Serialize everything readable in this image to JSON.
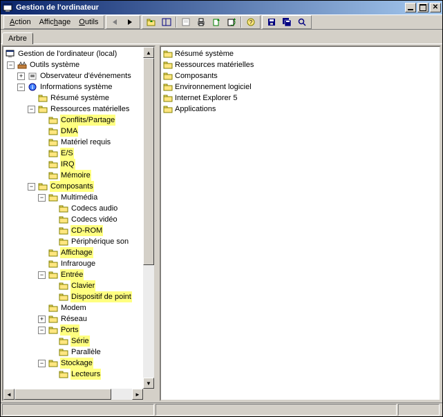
{
  "title": "Gestion de l'ordinateur",
  "menu": {
    "action": "Action",
    "affichage": "Affichage",
    "outils": "Outils"
  },
  "tab": "Arbre",
  "tree": {
    "root": "Gestion de l'ordinateur (local)",
    "outils_systeme": "Outils système",
    "observateur": "Observateur d'événements",
    "informations_systeme": "Informations système",
    "resume_systeme": "Résumé système",
    "ressources_materielles": "Ressources matérielles",
    "conflits_partage": "Conflits/Partage",
    "dma": "DMA",
    "materiel_requis": "Matériel requis",
    "es": "E/S",
    "irq": "IRQ",
    "memoire": "Mémoire",
    "composants": "Composants",
    "multimedia": "Multimédia",
    "codecs_audio": "Codecs audio",
    "codecs_video": "Codecs vidéo",
    "cdrom": "CD-ROM",
    "peripherique_son": "Périphérique son",
    "affichage": "Affichage",
    "infrarouge": "Infrarouge",
    "entree": "Entrée",
    "clavier": "Clavier",
    "dispositif_point": "Dispositif de point",
    "modem": "Modem",
    "reseau": "Réseau",
    "ports": "Ports",
    "serie": "Série",
    "parallele": "Parallèle",
    "stockage": "Stockage",
    "lecteurs": "Lecteurs"
  },
  "right": {
    "resume_systeme": "Résumé système",
    "ressources_materielles": "Ressources matérielles",
    "composants": "Composants",
    "environnement_logiciel": "Environnement logiciel",
    "ie5": "Internet Explorer 5",
    "applications": "Applications"
  }
}
